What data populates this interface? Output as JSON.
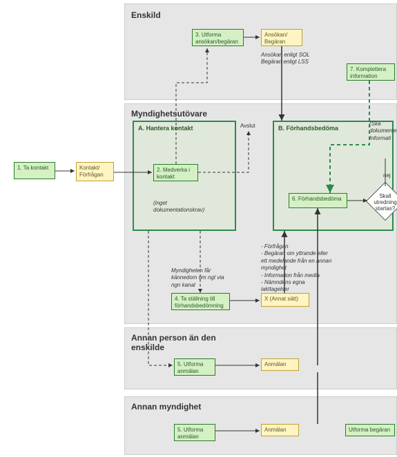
{
  "lanes": {
    "enskild": "Enskild",
    "myndighet": "Myndighetsutövare",
    "annan_person": "Annan person än den enskilde",
    "annan_myndighet": "Annan myndighet"
  },
  "boxes": {
    "b1": "1. Ta kontakt",
    "b_kontakt": "Kontakt/\nFörfrågan",
    "b2": "2. Medverka i\nkontakt",
    "b3": "3. Utforma\nansökan/begäran",
    "b_ansokan": "Ansökan/\nBegäran",
    "b4": "4. Ta ställning till\nförhandsbedömning",
    "bx": "X (Annat sätt)",
    "b5a": "5. Utforma\nanmälan",
    "b_anmalan_a": "Anmälan",
    "b5b": "5. Utforma\nanmälan",
    "b_anmalan_b": "Anmälan",
    "b_utforma_begaran": "Utforma begäran",
    "b6": "6. Förhandsbedöma",
    "b7": "7. Komplettera\ninformation"
  },
  "containers": {
    "a": "A. Hantera kontakt",
    "b": "B. Förhandsbedöma"
  },
  "notes": {
    "n_sol": "Ansökan enligt SOL\nBegäran enligt LSS",
    "n_dok": "(inget\ndokumentationskrav)",
    "n_avslut": "Avslut",
    "n_kanal": "Myndigheten får\nkännedom om ngt via\nngn kanal",
    "n_list": "- Förfrågan\n- Begäran om yttrande eller\nett medelande från en annan\nmyndighet\n- Information från media\n- Nämndens egna\niakttagelser",
    "n_ska": "(Ska\ndokumente\nInformati",
    "n_nej": "nej"
  },
  "decision": {
    "d1": "Skall\nutredning\nstartas?"
  }
}
